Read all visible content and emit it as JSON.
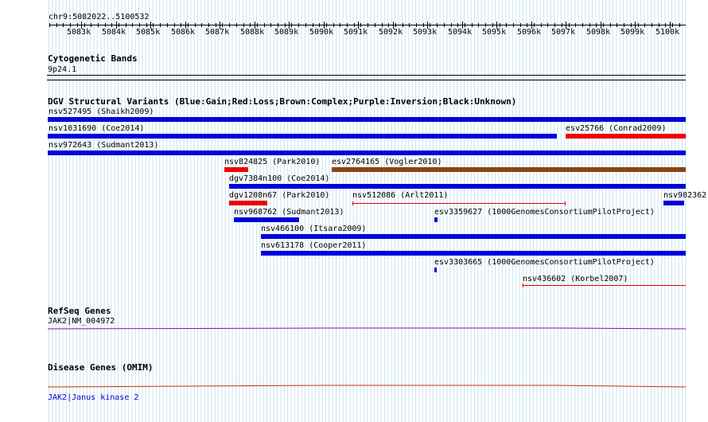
{
  "coordinate_label": "chr9:5082022..5100532",
  "ruler_ticks": [
    "5083k",
    "5084k",
    "5085k",
    "5086k",
    "5087k",
    "5088k",
    "5089k",
    "5090k",
    "5091k",
    "5092k",
    "5093k",
    "5094k",
    "5095k",
    "5096k",
    "5097k",
    "5098k",
    "5099k",
    "5100k"
  ],
  "tracks": {
    "cytobands": {
      "title": "Cytogenetic Bands",
      "band_label": "9p24.1"
    },
    "dgv": {
      "title": "DGV Structural Variants (Blue:Gain;Red:Loss;Brown:Complex;Purple:Inversion;Black:Unknown)",
      "colors": {
        "gain": "#0000dd",
        "loss": "#ee0000",
        "complex": "#8b4513"
      },
      "features": [
        {
          "label": "nsv527495 (Shaikh2009)"
        },
        {
          "label": "nsv1031690 (Coe2014)"
        },
        {
          "label": "esv25766 (Conrad2009)"
        },
        {
          "label": "nsv972643 (Sudmant2013)"
        },
        {
          "label": "nsv824825 (Park2010)"
        },
        {
          "label": "esv2764165 (Vogler2010)"
        },
        {
          "label": "dgv7384n100 (Coe2014)"
        },
        {
          "label": "dgv1208n67 (Park2010)"
        },
        {
          "label": "nsv512086 (Arlt2011)"
        },
        {
          "label": "nsv982362"
        },
        {
          "label": "nsv968762 (Sudmant2013)"
        },
        {
          "label": "esv3359627 (1000GenomesConsortiumPilotProject)"
        },
        {
          "label": "nsv466100 (Itsara2009)"
        },
        {
          "label": "nsv613178 (Cooper2011)"
        },
        {
          "label": "esv3303665 (1000GenomesConsortiumPilotProject)"
        },
        {
          "label": "nsv436602 (Korbel2007)"
        }
      ]
    },
    "refseq": {
      "title": "RefSeq Genes",
      "gene_label": "JAK2|NM_004972"
    },
    "omim": {
      "title": "Disease Genes (OMIM)",
      "gene_label": "JAK2|Janus kinase 2"
    }
  }
}
